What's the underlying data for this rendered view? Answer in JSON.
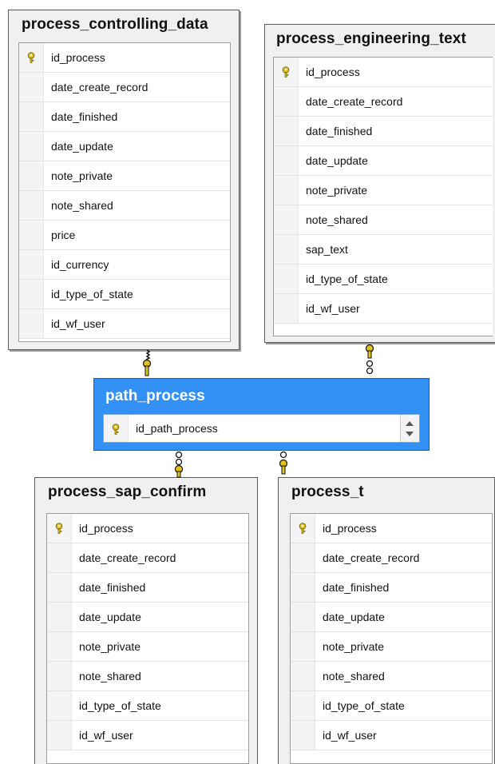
{
  "tables": {
    "process_controlling_data": {
      "title": "process_controlling_data",
      "columns": [
        "id_process",
        "date_create_record",
        "date_finished",
        "date_update",
        "note_private",
        "note_shared",
        "price",
        "id_currency",
        "id_type_of_state",
        "id_wf_user"
      ]
    },
    "process_engineering_text": {
      "title": "process_engineering_text",
      "columns": [
        "id_process",
        "date_create_record",
        "date_finished",
        "date_update",
        "note_private",
        "note_shared",
        "sap_text",
        "id_type_of_state",
        "id_wf_user"
      ]
    },
    "path_process": {
      "title": "path_process",
      "columns": [
        "id_path_process"
      ]
    },
    "process_sap_confirm": {
      "title": "process_sap_confirm",
      "columns": [
        "id_process",
        "date_create_record",
        "date_finished",
        "date_update",
        "note_private",
        "note_shared",
        "id_type_of_state",
        "id_wf_user"
      ]
    },
    "process_t": {
      "title": "process_t",
      "columns": [
        "id_process",
        "date_create_record",
        "date_finished",
        "date_update",
        "note_private",
        "note_shared",
        "id_type_of_state",
        "id_wf_user"
      ]
    }
  },
  "icons": {
    "primary_key": "key-icon",
    "relationship": "relationship-connector-icon"
  },
  "colors": {
    "selected_table": "#3391f5",
    "key_gold": "#e0c21a",
    "table_bg": "#f0f0f0"
  }
}
